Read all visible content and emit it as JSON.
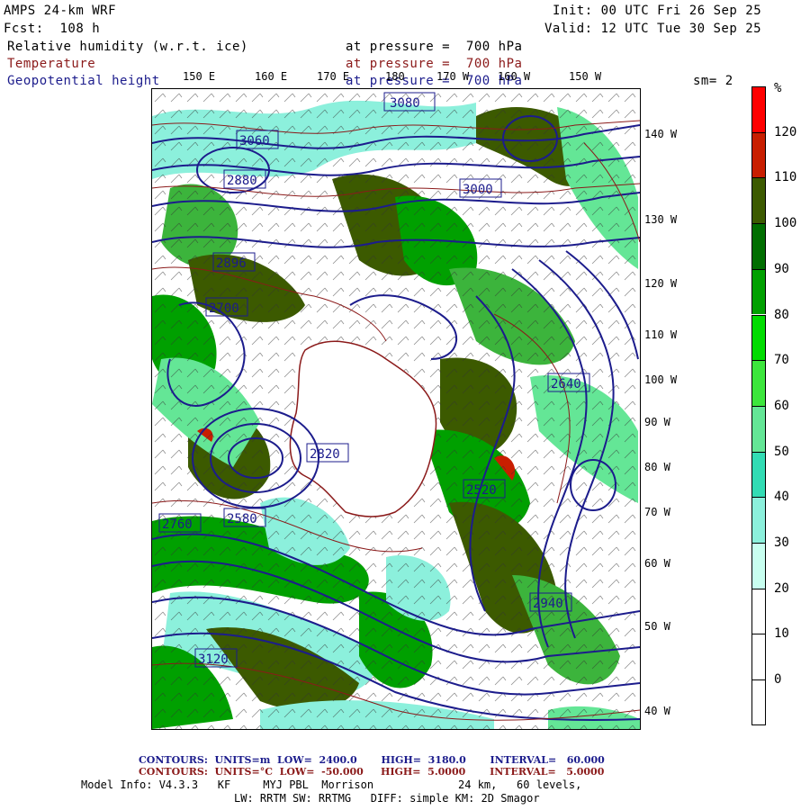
{
  "header": {
    "model": "AMPS 24-km WRF",
    "forecast": "Fcst:  108 h",
    "init": "Init: 00 UTC Fri 26 Sep 25",
    "valid": "Valid: 12 UTC Tue 30 Sep 25"
  },
  "fields": [
    {
      "name": "Relative humidity (w.r.t. ice)",
      "level": "at pressure =  700 hPa",
      "color": "#000000"
    },
    {
      "name": "Temperature",
      "level": "at pressure =  700 hPa",
      "color": "#8b1a1a"
    },
    {
      "name": "Geopotential height",
      "level": "at pressure =  700 hPa",
      "color": "#1c1c8c"
    }
  ],
  "smoothing": "sm= 2",
  "lon_labels": [
    "150 E",
    "160 E",
    "170 E",
    "180",
    "170 W",
    "160 W",
    "150 W"
  ],
  "lat_labels": [
    "140 W",
    "130 W",
    "120 W",
    "110 W",
    "100 W",
    "90 W",
    "80 W",
    "70 W",
    "60 W",
    "50 W",
    "40 W"
  ],
  "colorbar": {
    "unit": "%",
    "labels": [
      "120",
      "110",
      "100",
      "90",
      "80",
      "70",
      "60",
      "50",
      "40",
      "30",
      "20",
      "10",
      "0"
    ],
    "colors": [
      "#ff0000",
      "#c81e00",
      "#3c5a00",
      "#006e00",
      "#00a000",
      "#00dc00",
      "#3ce63c",
      "#64e696",
      "#32dcb4",
      "#8cf0dc",
      "#c8fff0",
      "#ffffff",
      "#ffffff",
      "#ffffff"
    ]
  },
  "contour_labels": [
    "3060",
    "3000",
    "2880",
    "2896",
    "2700",
    "2820",
    "2640",
    "2580",
    "2760",
    "3120",
    "3080",
    "2940",
    "2520"
  ],
  "footer": {
    "line1": "CONTOURS:  UNITS=m  LOW=  2400.0       HIGH=  3180.0       INTERVAL=   60.000",
    "line2": "CONTOURS:  UNITS=°C  LOW=  -50.000     HIGH=  5.0000       INTERVAL=   5.0000",
    "line3": "Model Info: V4.3.3   KF     MYJ PBL  Morrison             24 km,   60 levels,",
    "line4": "LW: RRTM SW: RRTMG   DIFF: simple KM: 2D Smagor"
  }
}
